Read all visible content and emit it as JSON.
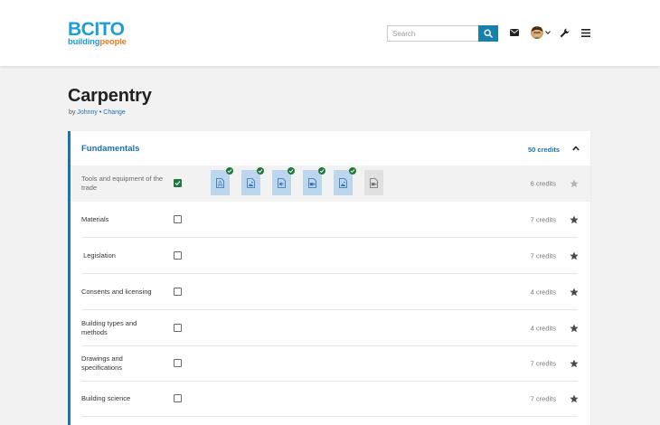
{
  "header": {
    "logo_main": "BCITO",
    "logo_sub_a": "building",
    "logo_sub_b": "people",
    "search_placeholder": "Search"
  },
  "page": {
    "title": "Carpentry",
    "by_prefix": "by",
    "author": "Johnny",
    "separator": "•",
    "change_label": "Change"
  },
  "section": {
    "title": "Fundamentals",
    "credits": "50 credits",
    "rows": [
      {
        "name": "Tools and equipment of the trade",
        "credits": "6 credits",
        "checked": true
      },
      {
        "name": "Materials",
        "credits": "7 credits",
        "checked": false
      },
      {
        "name": " Legislation",
        "credits": "7 credits",
        "checked": false
      },
      {
        "name": "Consents and licensing",
        "credits": "4 credits",
        "checked": false
      },
      {
        "name": "Building types and methods",
        "credits": "4 credits",
        "checked": false
      },
      {
        "name": "Drawings and specifications",
        "credits": "7 credits",
        "checked": false
      },
      {
        "name": "Building science",
        "credits": "7 credits",
        "checked": false
      }
    ],
    "resources": [
      {
        "icon": "pdf-document-icon",
        "status": "done"
      },
      {
        "icon": "image-document-icon",
        "status": "done"
      },
      {
        "icon": "audio-document-icon",
        "status": "done"
      },
      {
        "icon": "video-document-icon",
        "status": "done"
      },
      {
        "icon": "image-document-icon",
        "status": "done"
      },
      {
        "icon": "video-document-icon",
        "status": "pending"
      }
    ]
  },
  "colors": {
    "accent_blue": "#1b73b6",
    "search_button": "#1b7fad",
    "check_green": "#1f7a3a",
    "logo_blue": "#1d9fd6",
    "logo_orange": "#f07c1f"
  }
}
